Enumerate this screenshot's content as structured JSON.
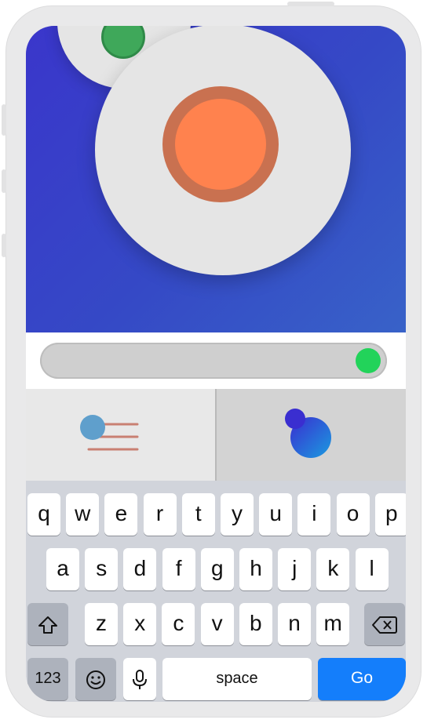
{
  "keyboard": {
    "row1": [
      "q",
      "w",
      "e",
      "r",
      "t",
      "y",
      "u",
      "i",
      "o",
      "p"
    ],
    "row2": [
      "a",
      "s",
      "d",
      "f",
      "g",
      "h",
      "j",
      "k",
      "l"
    ],
    "row3": [
      "z",
      "x",
      "c",
      "v",
      "b",
      "n",
      "m"
    ],
    "space_label": "space",
    "go_label": "Go",
    "numbers_label": "123"
  },
  "slider": {
    "value_fraction": 1.0
  },
  "colors": {
    "hero_blue": "#3a36cb",
    "plate": "#e5e5e5",
    "orange": "#ff824e",
    "green": "#3fa85a",
    "knob_green": "#22d35a",
    "go_blue": "#147efb"
  },
  "panes": {
    "left_icon": "list-filter-icon",
    "right_icon": "bubble-icon"
  }
}
